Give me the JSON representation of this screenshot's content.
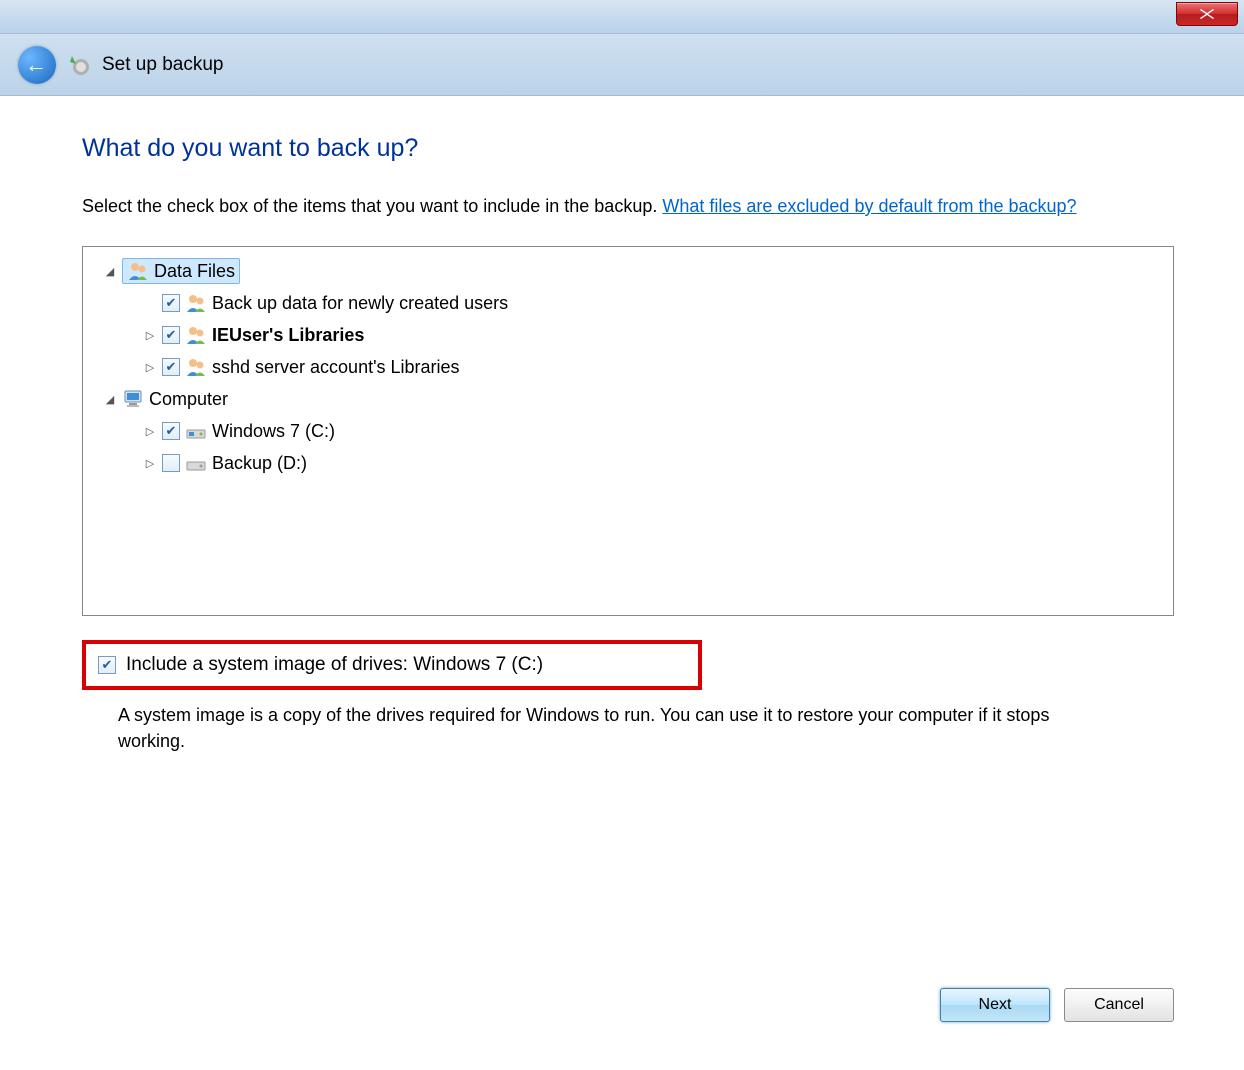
{
  "header": {
    "title": "Set up backup"
  },
  "main": {
    "heading": "What do you want to back up?",
    "instruction_prefix": "Select the check box of the items that you want to include in the backup. ",
    "instruction_link": "What files are excluded by default from the backup?"
  },
  "tree": {
    "data_files": {
      "label": "Data Files",
      "items": [
        {
          "label": "Back up data for newly created users",
          "checked": true,
          "expandable": false,
          "bold": false
        },
        {
          "label": "IEUser's Libraries",
          "checked": true,
          "expandable": true,
          "bold": true
        },
        {
          "label": "sshd server account's Libraries",
          "checked": true,
          "expandable": true,
          "bold": false
        }
      ]
    },
    "computer": {
      "label": "Computer",
      "items": [
        {
          "label": "Windows 7 (C:)",
          "checked": true,
          "expandable": true
        },
        {
          "label": "Backup (D:)",
          "checked": false,
          "expandable": true
        }
      ]
    }
  },
  "system_image": {
    "checkbox_label": "Include a system image of drives: Windows 7 (C:)",
    "checked": true,
    "description": "A system image is a copy of the drives required for Windows to run. You can use it to restore your computer if it stops working."
  },
  "buttons": {
    "next": "Next",
    "cancel": "Cancel"
  }
}
